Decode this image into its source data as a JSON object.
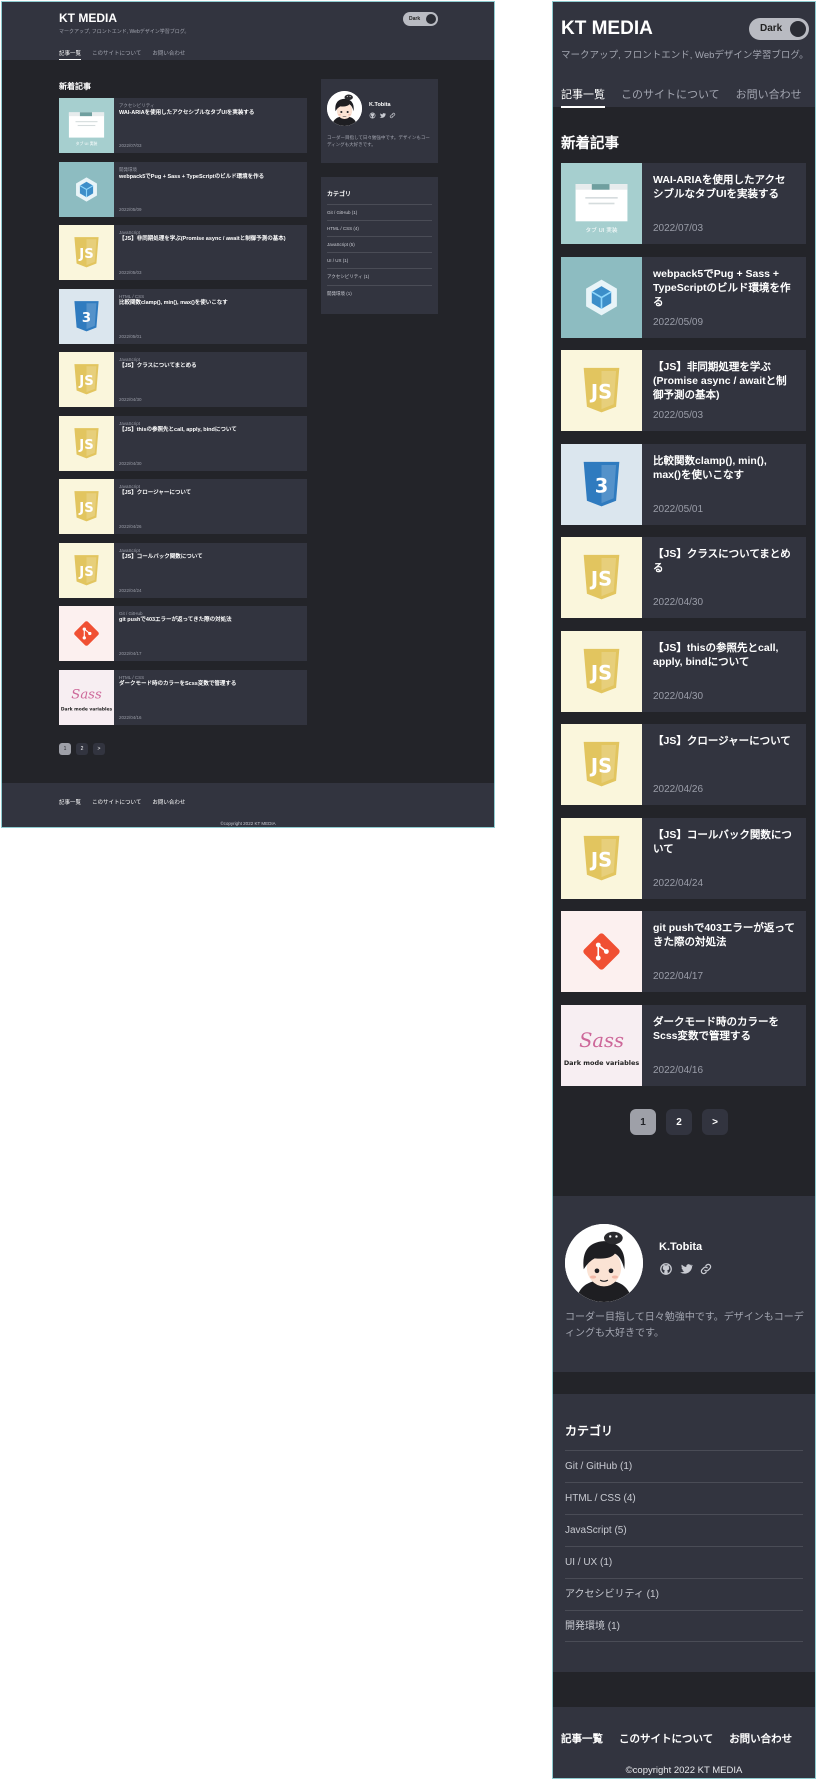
{
  "site": {
    "logo": "KT MEDIA",
    "tagline": "マークアップ, フロントエンド, Webデザイン学習ブログ。",
    "theme_toggle_label": "Dark"
  },
  "nav": {
    "items": [
      "記事一覧",
      "このサイトについて",
      "お問い合わせ"
    ],
    "active": "記事一覧"
  },
  "main": {
    "section_title": "新着記事",
    "articles": [
      {
        "category": "アクセシビリティ",
        "title": "WAI-ARIAを使用したアクセシブルなタブUIを実装する",
        "date": "2022/07/03",
        "thumb": "tab-ui"
      },
      {
        "category": "開発環境",
        "title": "webpack5でPug + Sass + TypeScriptのビルド環境を作る",
        "date": "2022/05/09",
        "thumb": "webpack"
      },
      {
        "category": "JavaScript",
        "title": "【JS】非同期処理を学ぶ(Promise async / awaitと制御予測の基本)",
        "date": "2022/05/03",
        "thumb": "js"
      },
      {
        "category": "HTML / CSS",
        "title": "比較関数clamp(), min(), max()を使いこなす",
        "date": "2022/05/01",
        "thumb": "css3"
      },
      {
        "category": "JavaScript",
        "title": "【JS】クラスについてまとめる",
        "date": "2022/04/30",
        "thumb": "js"
      },
      {
        "category": "JavaScript",
        "title": "【JS】thisの参照先とcall, apply, bindについて",
        "date": "2022/04/30",
        "thumb": "js"
      },
      {
        "category": "JavaScript",
        "title": "【JS】クロージャーについて",
        "date": "2022/04/26",
        "thumb": "js"
      },
      {
        "category": "JavaScript",
        "title": "【JS】コールバック関数について",
        "date": "2022/04/24",
        "thumb": "js"
      },
      {
        "category": "Git / GitHub",
        "title": "git pushで403エラーが返ってきた際の対処法",
        "date": "2022/04/17",
        "thumb": "git"
      },
      {
        "category": "HTML / CSS",
        "title": "ダークモード時のカラーをScss変数で管理する",
        "date": "2022/04/16",
        "thumb": "sass"
      }
    ],
    "thumb_texts": {
      "tab_ui_caption": "タブ UI 実装",
      "sass_word": "Sass",
      "sass_caption": "Dark mode variables"
    },
    "pagination": [
      "1",
      "2",
      ">"
    ]
  },
  "profile": {
    "name": "K.Tobita",
    "description": "コーダー目指して日々勉強中です。デザインもコーディングも大好きです。",
    "links": [
      "github-icon",
      "twitter-icon",
      "link-icon"
    ]
  },
  "categories": {
    "title": "カテゴリ",
    "items": [
      "Git / GitHub (1)",
      "HTML / CSS (4)",
      "JavaScript (5)",
      "UI / UX (1)",
      "アクセシビリティ (1)",
      "開発環境 (1)"
    ]
  },
  "footer": {
    "nav": [
      "記事一覧",
      "このサイトについて",
      "お問い合わせ"
    ],
    "copyright": "©copyright 2022 KT MEDIA"
  },
  "colors": {
    "background": "#232429",
    "surface": "#32343f",
    "frame_border": "#8ecbd0",
    "js_yellow": "#f0db4f",
    "css_blue": "#2965f1",
    "git_red": "#f05033",
    "sass_pink": "#cd6799"
  }
}
